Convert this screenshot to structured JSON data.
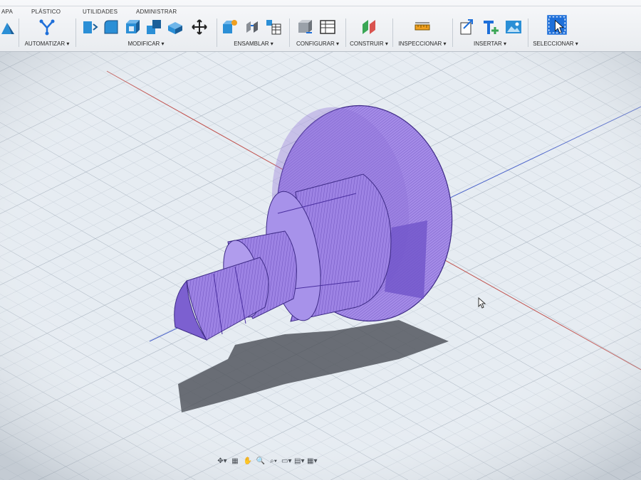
{
  "tabs": [
    {
      "label": "APA"
    },
    {
      "label": "PLÁSTICO"
    },
    {
      "label": "UTILIDADES"
    },
    {
      "label": "ADMINISTRAR"
    }
  ],
  "groups": [
    {
      "label": "AUTOMATIZAR ▾"
    },
    {
      "label": "MODIFICAR ▾"
    },
    {
      "label": "ENSAMBLAR ▾"
    },
    {
      "label": "CONFIGURAR ▾"
    },
    {
      "label": "CONSTRUIR ▾"
    },
    {
      "label": "INSPECCIONAR ▾"
    },
    {
      "label": "INSERTAR ▾"
    },
    {
      "label": "SELECCIONAR ▾"
    }
  ],
  "icons": [
    "sketch-icon",
    "automate-icon",
    "press-pull-icon",
    "fillet-icon",
    "shell-icon",
    "combine-icon",
    "replace-face-icon",
    "move-icon",
    "new-component-icon",
    "joint-icon",
    "assembly-table-icon",
    "configure-icon",
    "config-table-icon",
    "construct-plane-icon",
    "measure-icon",
    "insert-derive-icon",
    "insert-text-icon",
    "insert-image-icon",
    "select-icon"
  ],
  "navbar": [
    "✥▾",
    "▦",
    "✋",
    "🔍",
    "⌕▾",
    "▭▾",
    "▤▾",
    "▦▾"
  ],
  "colors": {
    "model": "#9b7fe0",
    "model_dark": "#6f52c4",
    "grid": "#c9d1da",
    "axis_red": "#c0514d",
    "axis_blue": "#4b63c9",
    "accent": "#1e6fd9"
  }
}
